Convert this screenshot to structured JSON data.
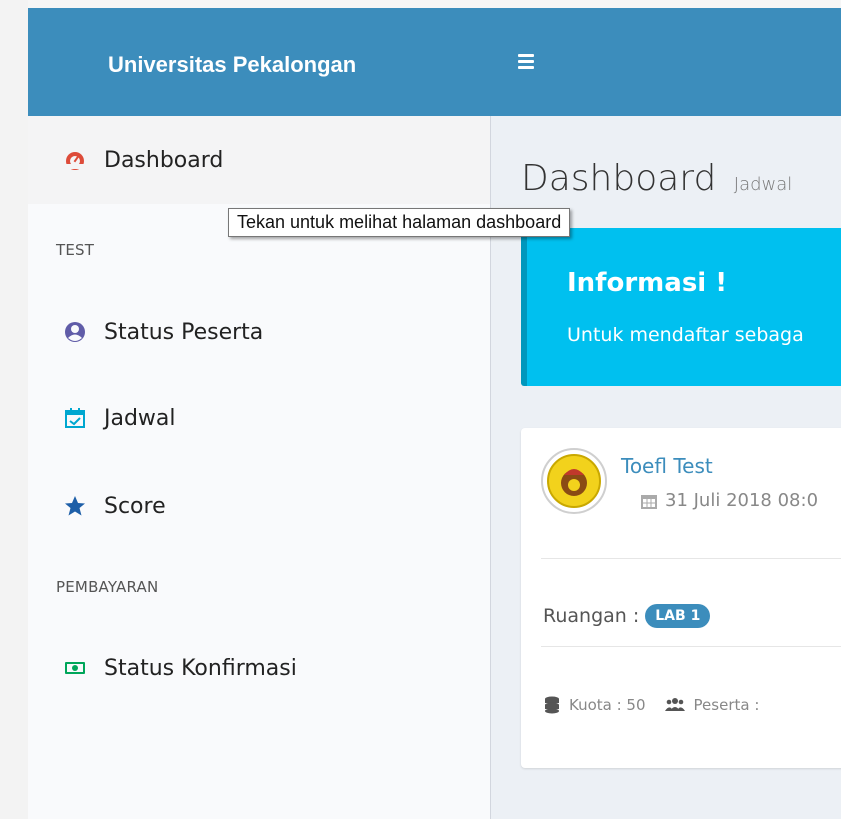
{
  "header": {
    "brand": "Universitas Pekalongan",
    "menu_icon": "hamburger-icon"
  },
  "sidebar": {
    "items": [
      {
        "label": "Dashboard",
        "icon": "dashboard-icon"
      },
      {
        "label": "Status Peserta",
        "icon": "user-circle-icon"
      },
      {
        "label": "Jadwal",
        "icon": "calendar-check-icon"
      },
      {
        "label": "Score",
        "icon": "star-icon"
      },
      {
        "label": "Status Konfirmasi",
        "icon": "money-icon"
      }
    ],
    "headers": [
      "TEST",
      "PEMBAYARAN"
    ]
  },
  "tooltip": "Tekan untuk melihat halaman dashboard",
  "main": {
    "title": "Dashboard",
    "subtitle": "Jadwal",
    "callout": {
      "title": "Informasi !",
      "text": "Untuk mendaftar sebaga"
    },
    "card": {
      "title": "Toefl Test",
      "date": "31 Juli 2018 08:0",
      "room_label": "Ruangan :",
      "room_badge": "LAB 1",
      "quota": "Kuota : 50",
      "participants": "Peserta :"
    }
  },
  "colors": {
    "primary": "#3c8dbc",
    "info": "#00c0ef",
    "dashboard_icon": "#dd4b39",
    "user_icon": "#605ca8",
    "calendar_icon": "#00a7d0",
    "star_icon": "#1e5fa8",
    "money_icon": "#00a65a"
  }
}
